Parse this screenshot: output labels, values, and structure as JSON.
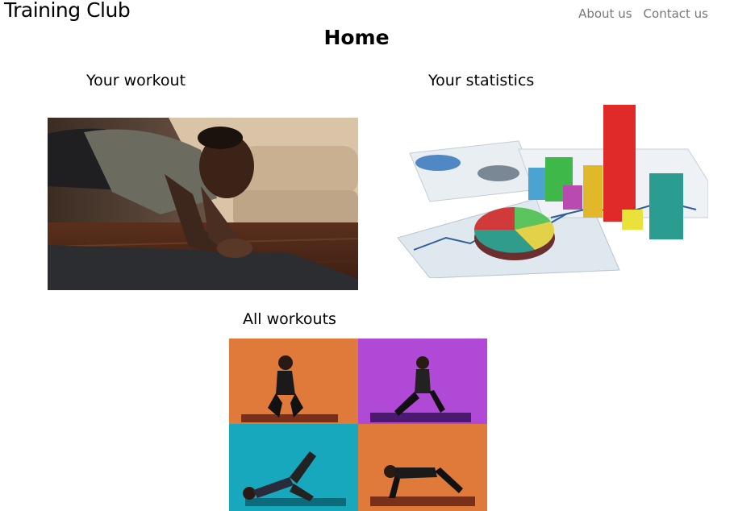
{
  "header": {
    "brand": "Training Club",
    "nav": [
      {
        "label": "About us"
      },
      {
        "label": "Contact us"
      }
    ]
  },
  "page": {
    "title": "Home"
  },
  "sections": {
    "workout": {
      "title": "Your workout",
      "image_icon": "plank-photo"
    },
    "statistics": {
      "title": "Your statistics",
      "image_icon": "3d-charts-image"
    },
    "all_workouts": {
      "title": "All workouts",
      "image_icon": "workout-collage-image"
    }
  }
}
